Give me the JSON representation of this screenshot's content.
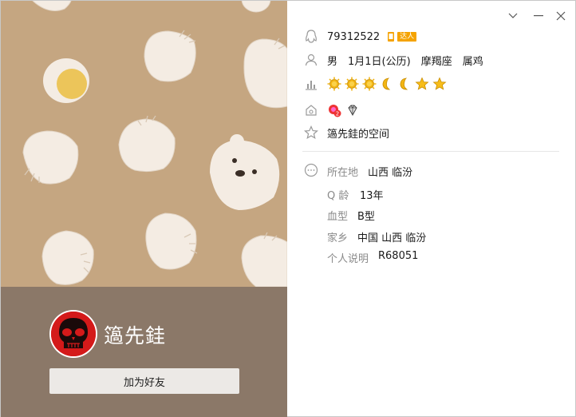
{
  "profile": {
    "nickname": "簻先銈",
    "add_friend_label": "加为好友"
  },
  "info": {
    "qq_number": "79312522",
    "vip_tag": "达人",
    "gender": "男",
    "birthday": "1月1日(公历)",
    "zodiac": "摩羯座",
    "chinese_zodiac": "属鸡",
    "level_icons": [
      "sun-icon",
      "sun-icon",
      "sun-icon",
      "moon-icon",
      "moon-icon",
      "star-icon",
      "star-icon"
    ],
    "space_link": "簻先銈的空间"
  },
  "details": [
    {
      "label": "所在地",
      "value": "山西 临汾"
    },
    {
      "label": "Q 龄",
      "value": "13年"
    },
    {
      "label": "血型",
      "value": "B型"
    },
    {
      "label": "家乡",
      "value": "中国 山西 临汾"
    },
    {
      "label": "个人说明",
      "value": "R68051"
    }
  ],
  "colors": {
    "cover_bg": "#c5a681",
    "profile_band": "#8b7868",
    "accent": "#f5a300"
  }
}
